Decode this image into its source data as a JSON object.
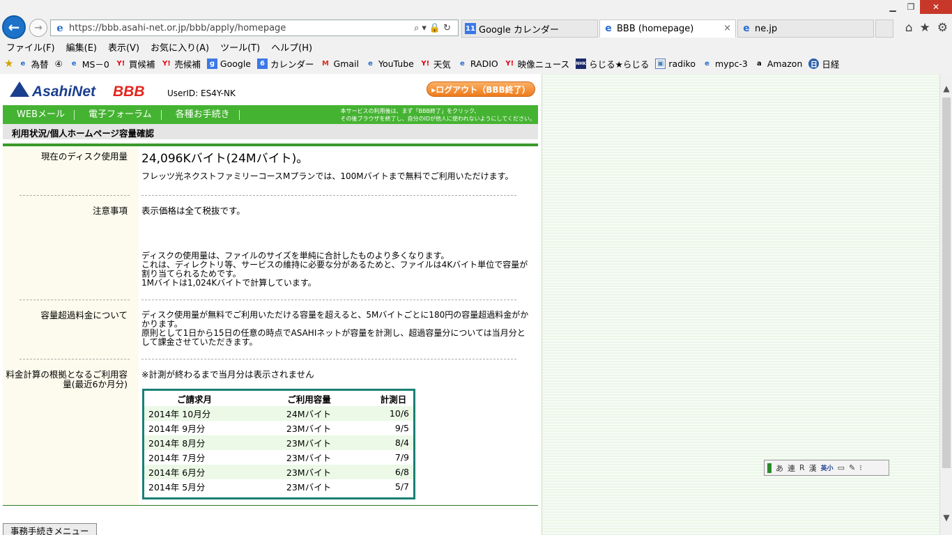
{
  "browser": {
    "url": "https://bbb.asahi-net.or.jp/bbb/apply/homepage",
    "tabs": [
      {
        "label": "Google カレンダー",
        "icon": "calendar-icon",
        "active": false
      },
      {
        "label": "BBB (homepage)",
        "icon": "ie-icon",
        "active": true
      },
      {
        "label": "ne.jp",
        "icon": "ie-icon",
        "active": false
      }
    ],
    "tab_close": "×",
    "menu": [
      "ファイル(F)",
      "編集(E)",
      "表示(V)",
      "お気に入り(A)",
      "ツール(T)",
      "ヘルプ(H)"
    ],
    "favorites": [
      {
        "label": "為替",
        "icon": "ie-icon"
      },
      {
        "label": "④",
        "icon": ""
      },
      {
        "label": "MS－0",
        "icon": "ie-icon"
      },
      {
        "label": "買候補",
        "icon": "yahoo-icon"
      },
      {
        "label": "売候補",
        "icon": "yahoo-icon"
      },
      {
        "label": "Google",
        "icon": "google-icon"
      },
      {
        "label": "カレンダー",
        "icon": "calendar-icon"
      },
      {
        "label": "Gmail",
        "icon": "gmail-icon"
      },
      {
        "label": "YouTube",
        "icon": "ie-icon"
      },
      {
        "label": "天気",
        "icon": "yahoo-icon"
      },
      {
        "label": "RADIO",
        "icon": "ie-icon"
      },
      {
        "label": "映像ニュース",
        "icon": "yahoo-icon"
      },
      {
        "label": "らじる★らじる",
        "icon": "nhk-icon"
      },
      {
        "label": "radiko",
        "icon": "image-icon"
      },
      {
        "label": "mypc-3",
        "icon": "ie-icon"
      },
      {
        "label": "Amazon",
        "icon": "amazon-icon"
      },
      {
        "label": "日経",
        "icon": "nikkei-icon"
      }
    ]
  },
  "header": {
    "logo": "AsahiNet",
    "logo_sub": "BBB",
    "userid": "UserID: ES4Y-NK",
    "logout": "▸ログアウト（BBB終了）"
  },
  "nav": {
    "items": [
      "WEBメール",
      "電子フォーラム",
      "各種お手続き"
    ],
    "note_line1": "本サービスの利用後は、まず「BBB終了」をクリック、",
    "note_line2": "その後ブラウザを終了し、自分のIDが他人に使われないようにしてください。"
  },
  "page": {
    "title": "利用状況/個人ホームページ容量確認",
    "rows": {
      "usage": {
        "label": "現在のディスク使用量",
        "value": "24,096Kバイト(24Mバイト)。",
        "note": "フレッツ光ネクストファミリーコースMプランでは、100Mバイトまで無料でご利用いただけます。"
      },
      "notice": {
        "label": "注意事項",
        "line1": "表示価格は全て税抜です。",
        "line2": "ディスクの使用量は、ファイルのサイズを単純に合計したものより多くなります。",
        "line3": "これは、ディレクトリ等、サービスの維持に必要な分があるためと、ファイルは4Kバイト単位で容量が割り当てられるためです。",
        "line4": "1Mバイトは1,024Kバイトで計算しています。"
      },
      "overage": {
        "label": "容量超過料金について",
        "line1": "ディスク使用量が無料でご利用いただける容量を超えると、5Mバイトごとに180円の容量超過料金がかかります。",
        "line2": "原則として1日から15日の任意の時点でASAHIネットが容量を計測し、超過容量分については当月分として課金させていただきます。"
      },
      "history": {
        "label": "料金計算の根拠となるご利用容量(最近6か月分)",
        "note": "※計測が終わるまで当月分は表示されません"
      }
    },
    "table": {
      "headers": [
        "ご請求月",
        "ご利用容量",
        "計測日"
      ],
      "rows": [
        [
          "2014年 10月分",
          "24Mバイト",
          "10/6"
        ],
        [
          "2014年 9月分",
          "23Mバイト",
          "9/5"
        ],
        [
          "2014年 8月分",
          "23Mバイト",
          "8/4"
        ],
        [
          "2014年 7月分",
          "23Mバイト",
          "7/9"
        ],
        [
          "2014年 6月分",
          "23Mバイト",
          "6/8"
        ],
        [
          "2014年 5月分",
          "23Mバイト",
          "5/7"
        ]
      ]
    },
    "back_button": "事務手続きメニューへ"
  },
  "ime": {
    "items": [
      "あ",
      "連",
      "R",
      "漢",
      "英小"
    ]
  }
}
